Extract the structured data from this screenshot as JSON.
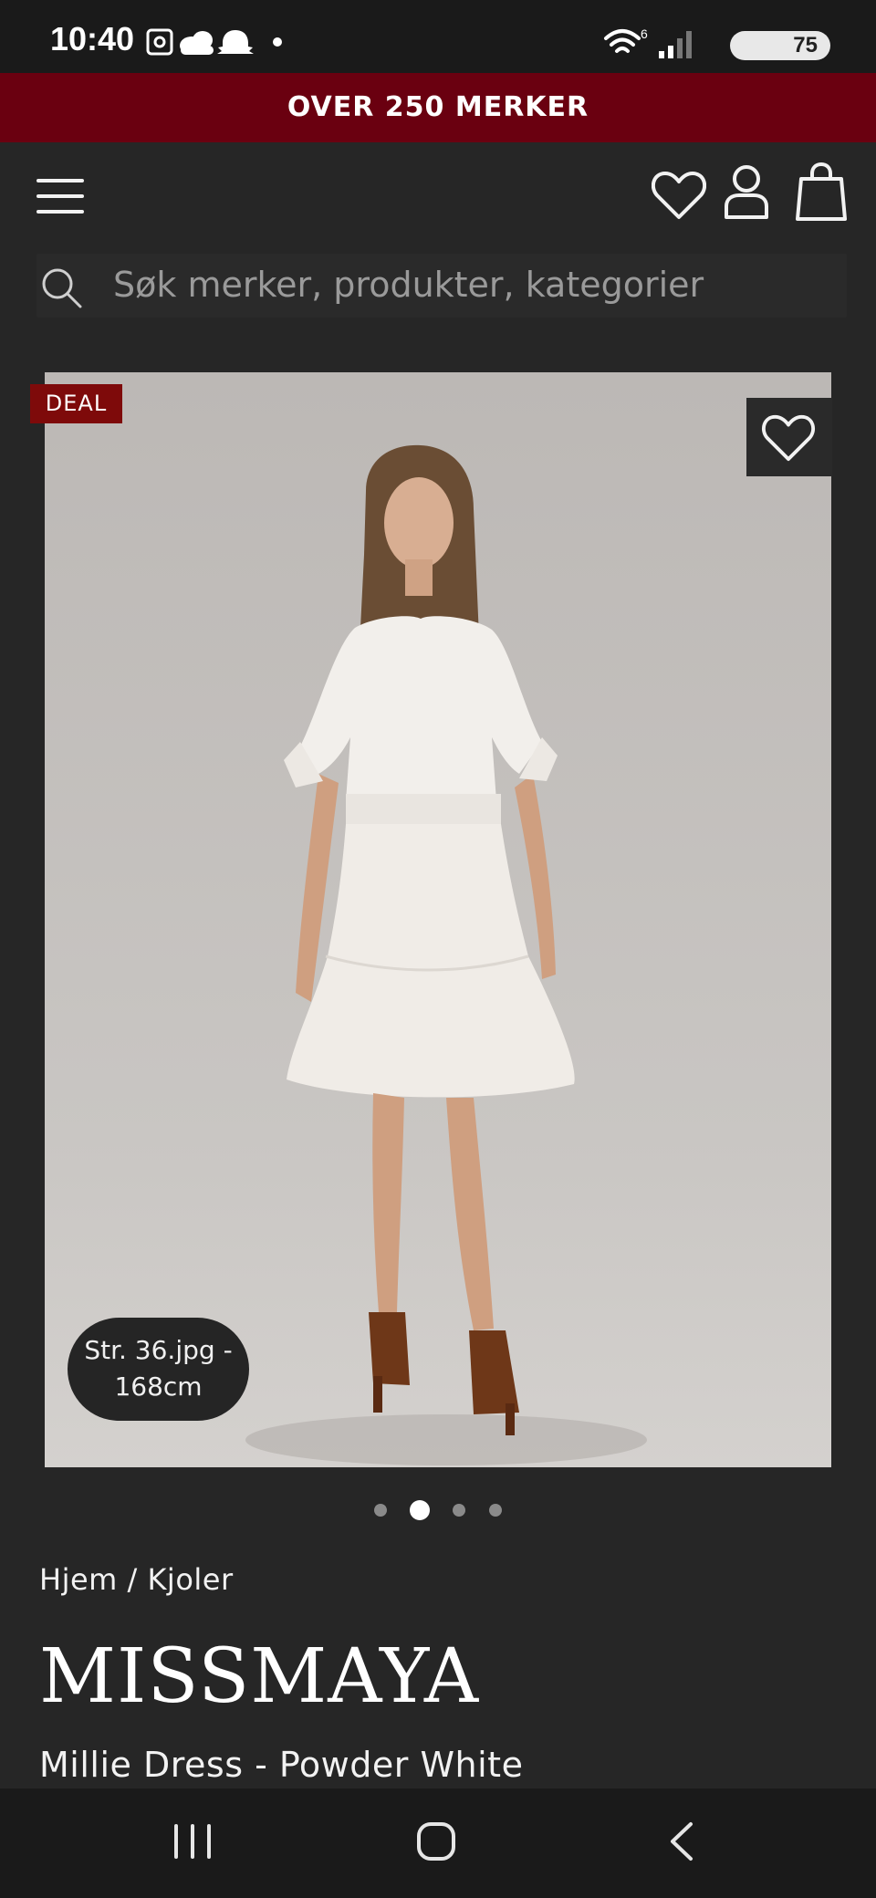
{
  "status_bar": {
    "time": "10:40",
    "battery": "75",
    "left_icons": [
      "screenshot-icon",
      "cloud-icon",
      "snapchat-icon",
      "dot-icon"
    ],
    "right_icons": [
      "wifi-icon",
      "signal-icon",
      "battery-icon"
    ]
  },
  "promo": {
    "text": "OVER 250 MERKER"
  },
  "header": {
    "icons": [
      "menu-icon",
      "heart-icon",
      "user-icon",
      "bag-icon"
    ]
  },
  "search": {
    "placeholder": "Søk merker, produkter, kategorier"
  },
  "product": {
    "badge": "DEAL",
    "size_info": "Str. 36.jpg - 168cm",
    "image_count": 4,
    "active_image": 2,
    "breadcrumb": "Hjem / Kjoler",
    "brand": "MISSMAYA",
    "name": "Millie Dress - Powder White"
  },
  "nav_bar": {
    "icons": [
      "recent-apps-icon",
      "home-icon",
      "back-icon"
    ]
  }
}
